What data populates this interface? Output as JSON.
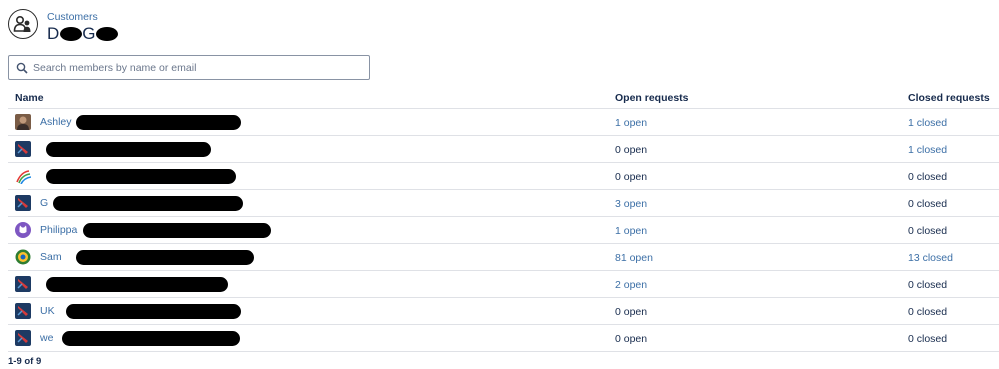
{
  "breadcrumb": {
    "label": "Customers"
  },
  "org": {
    "title": "D G",
    "title_first": "D",
    "title_second": "G"
  },
  "search": {
    "placeholder": "Search members by name or email",
    "value": ""
  },
  "table": {
    "headers": {
      "name": "Name",
      "open": "Open requests",
      "closed": "Closed requests"
    },
    "rows": [
      {
        "name": "Ashley",
        "avatar": "photo-avatar",
        "open": "1 open",
        "open_link": true,
        "closed": "1 closed",
        "closed_link": true
      },
      {
        "name": "",
        "avatar": "default-avatar",
        "open": "0 open",
        "open_link": false,
        "closed": "1 closed",
        "closed_link": true
      },
      {
        "name": "",
        "avatar": "rainbow-avatar",
        "open": "0 open",
        "open_link": false,
        "closed": "0 closed",
        "closed_link": false
      },
      {
        "name": "G",
        "avatar": "default-avatar",
        "open": "3 open",
        "open_link": true,
        "closed": "0 closed",
        "closed_link": false
      },
      {
        "name": "Philippa",
        "avatar": "cat-avatar",
        "open": "1 open",
        "open_link": true,
        "closed": "0 closed",
        "closed_link": false
      },
      {
        "name": "Sam",
        "avatar": "badge-avatar",
        "open": "81 open",
        "open_link": true,
        "closed": "13 closed",
        "closed_link": true
      },
      {
        "name": "",
        "avatar": "default-avatar",
        "open": "2 open",
        "open_link": true,
        "closed": "0 closed",
        "closed_link": false
      },
      {
        "name": "UK",
        "avatar": "default-avatar",
        "open": "0 open",
        "open_link": false,
        "closed": "0 closed",
        "closed_link": false
      },
      {
        "name": "we",
        "avatar": "default-avatar",
        "open": "0 open",
        "open_link": false,
        "closed": "0 closed",
        "closed_link": false
      }
    ]
  },
  "pagination": {
    "label": "1-9 of 9"
  },
  "colors": {
    "link": "#3c6fa6",
    "text": "#172b4d",
    "border": "#dfe1e6",
    "redaction": "#000000"
  }
}
